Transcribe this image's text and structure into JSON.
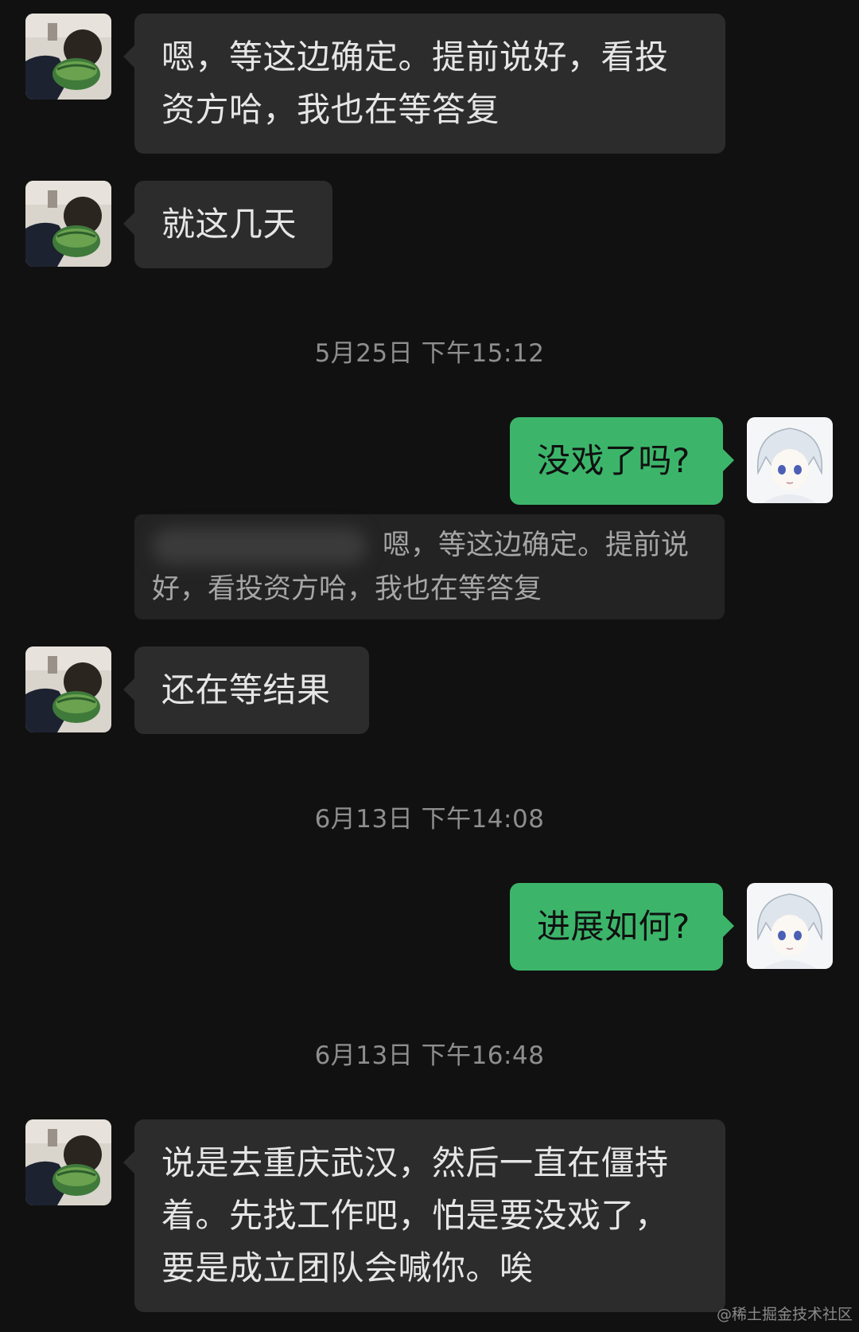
{
  "messages": [
    {
      "side": "left",
      "text": "嗯，等这边确定。提前说好，看投资方哈，我也在等答复"
    },
    {
      "side": "left",
      "text": "就这几天"
    },
    {
      "side": "right",
      "text": "没戏了吗?"
    },
    {
      "side": "left",
      "text": "还在等结果"
    },
    {
      "side": "right",
      "text": "进展如何?"
    },
    {
      "side": "left",
      "text": "说是去重庆武汉，然后一直在僵持着。先找工作吧，怕是要没戏了，要是成立团队会喊你。唉"
    }
  ],
  "times": [
    "5月25日 下午15:12",
    "6月13日 下午14:08",
    "6月13日 下午16:48"
  ],
  "quote": {
    "text": "嗯，等这边确定。提前说好，看投资方哈，我也在等答复"
  },
  "watermark": "@稀土掘金技术社区",
  "colors": {
    "background": "#111111",
    "left_bubble": "#2c2c2c",
    "right_bubble": "#3cb56a",
    "time_text": "#8e8e8e"
  },
  "icons": {
    "contact_avatar": "boy-eating-watermelon-avatar",
    "self_avatar": "white-haired-anime-avatar"
  }
}
